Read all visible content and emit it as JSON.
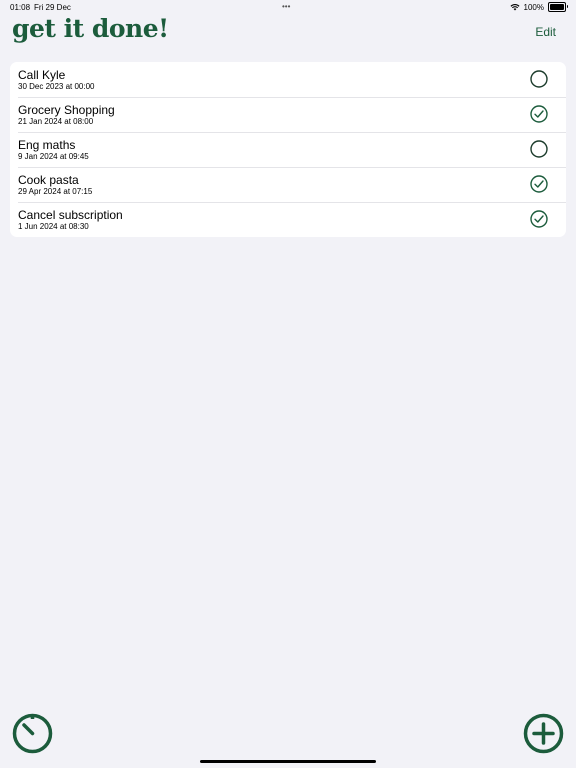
{
  "status_bar": {
    "time": "01:08",
    "date": "Fri 29 Dec",
    "battery": "100%",
    "wifi_icon": "wifi-icon",
    "battery_icon": "battery-icon"
  },
  "header": {
    "title": "get it done!",
    "edit_label": "Edit"
  },
  "tasks": [
    {
      "title": "Call Kyle",
      "date": "30 Dec 2023 at 00:00",
      "done": false
    },
    {
      "title": "Grocery Shopping",
      "date": "21 Jan 2024 at 08:00",
      "done": true
    },
    {
      "title": "Eng maths",
      "date": "9 Jan 2024 at 09:45",
      "done": false
    },
    {
      "title": "Cook pasta",
      "date": "29 Apr 2024 at 07:15",
      "done": true
    },
    {
      "title": "Cancel subscription",
      "date": "1 Jun 2024 at 08:30",
      "done": true
    }
  ],
  "toolbar": {
    "timer_icon": "timer-icon",
    "add_icon": "plus-circle-icon"
  },
  "colors": {
    "accent": "#1c5c3c",
    "background": "#f2f2f7",
    "card": "#ffffff"
  }
}
